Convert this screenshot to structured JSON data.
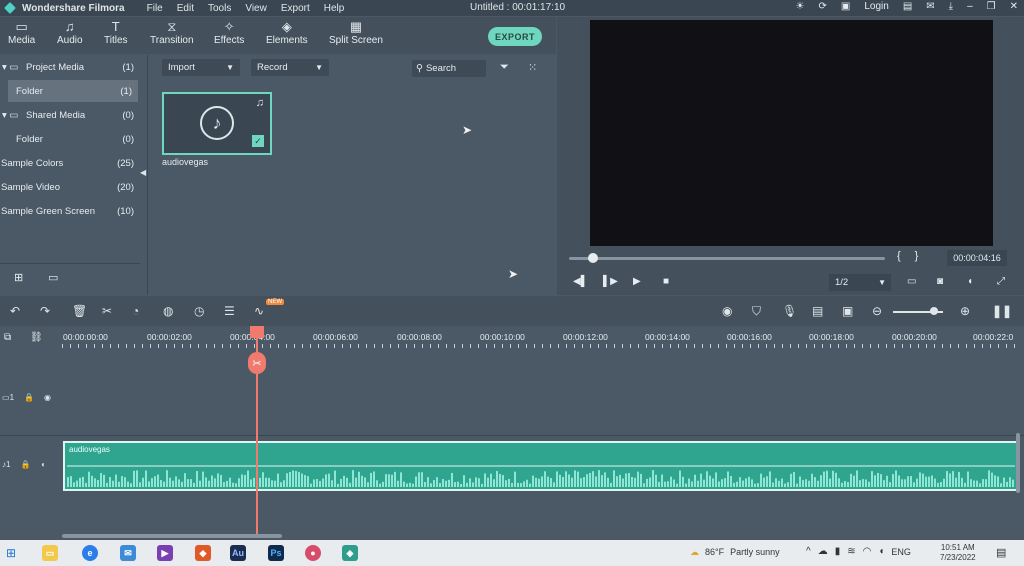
{
  "titlebar": {
    "app_name": "Wondershare Filmora",
    "menu": [
      "File",
      "Edit",
      "Tools",
      "View",
      "Export",
      "Help"
    ],
    "document": "Untitled : 00:01:17:10",
    "login": "Login"
  },
  "toolbar": {
    "items": [
      {
        "label": "Media",
        "icon": "folder-icon"
      },
      {
        "label": "Audio",
        "icon": "music-note-icon"
      },
      {
        "label": "Titles",
        "icon": "text-icon"
      },
      {
        "label": "Transition",
        "icon": "transition-icon"
      },
      {
        "label": "Effects",
        "icon": "effects-icon"
      },
      {
        "label": "Elements",
        "icon": "elements-icon"
      },
      {
        "label": "Split Screen",
        "icon": "split-screen-icon"
      }
    ],
    "export_label": "EXPORT"
  },
  "sidebar": {
    "items": [
      {
        "label": "Project Media",
        "count": "(1)"
      },
      {
        "label": "Folder",
        "count": "(1)"
      },
      {
        "label": "Shared Media",
        "count": "(0)"
      },
      {
        "label": "Folder",
        "count": "(0)"
      },
      {
        "label": "Sample Colors",
        "count": "(25)"
      },
      {
        "label": "Sample Video",
        "count": "(20)"
      },
      {
        "label": "Sample Green Screen",
        "count": "(10)"
      }
    ]
  },
  "media": {
    "import_label": "Import",
    "record_label": "Record",
    "search_placeholder": "Search",
    "clip_name": "audiovegas"
  },
  "preview": {
    "timecode": "00:00:04:16",
    "ratio": "1/2",
    "progress": 0.06
  },
  "timeline": {
    "new_badge": "NEW",
    "ruler": [
      "00:00:00:00",
      "00:00:02:00",
      "00:00:04:00",
      "00:00:06:00",
      "00:00:08:00",
      "00:00:10:00",
      "00:00:12:00",
      "00:00:14:00",
      "00:00:16:00",
      "00:00:18:00",
      "00:00:20:00",
      "00:00:22:0"
    ],
    "video_track_label": "1",
    "audio_track_label": "1",
    "audio_clip_name": "audiovegas"
  },
  "taskbar": {
    "weather": {
      "temp": "86°F",
      "condition": "Partly sunny"
    },
    "language": "ENG",
    "time": "10:51 AM",
    "date": "7/23/2022"
  }
}
